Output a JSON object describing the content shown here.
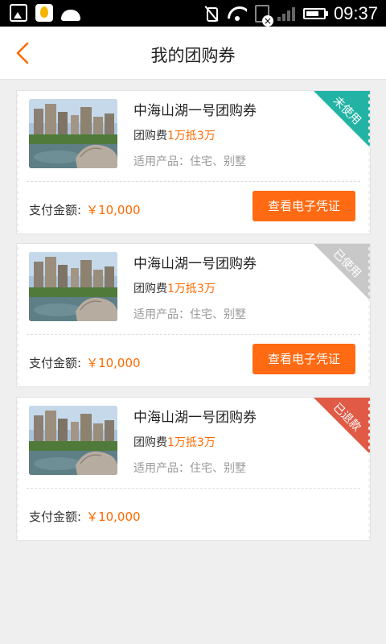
{
  "status_bar": {
    "time": "09:37",
    "icons": [
      "image-icon",
      "maps-icon",
      "android-icon",
      "mute-icon",
      "wifi-icon",
      "sim-icon",
      "signal-icon",
      "battery-icon"
    ]
  },
  "header": {
    "back_icon": "chevron-left-icon",
    "title": "我的团购券"
  },
  "colors": {
    "accent": "#ff6a00",
    "unused": "#22b3a4",
    "used": "#c8c8c8",
    "refunded": "#e05a45"
  },
  "coupons": [
    {
      "title": "中海山湖一号团购券",
      "price_label": "团购费",
      "price_value": "1万抵3万",
      "products": "适用产品：住宅、别墅",
      "pay_label": "支付金额:",
      "pay_amount": "￥10,000",
      "button": "查看电子凭证",
      "status": "未使用"
    },
    {
      "title": "中海山湖一号团购券",
      "price_label": "团购费",
      "price_value": "1万抵3万",
      "products": "适用产品：住宅、别墅",
      "pay_label": "支付金额:",
      "pay_amount": "￥10,000",
      "button": "查看电子凭证",
      "status": "已使用"
    },
    {
      "title": "中海山湖一号团购券",
      "price_label": "团购费",
      "price_value": "1万抵3万",
      "products": "适用产品：住宅、别墅",
      "pay_label": "支付金额:",
      "pay_amount": "￥10,000",
      "status": "已退款"
    }
  ]
}
